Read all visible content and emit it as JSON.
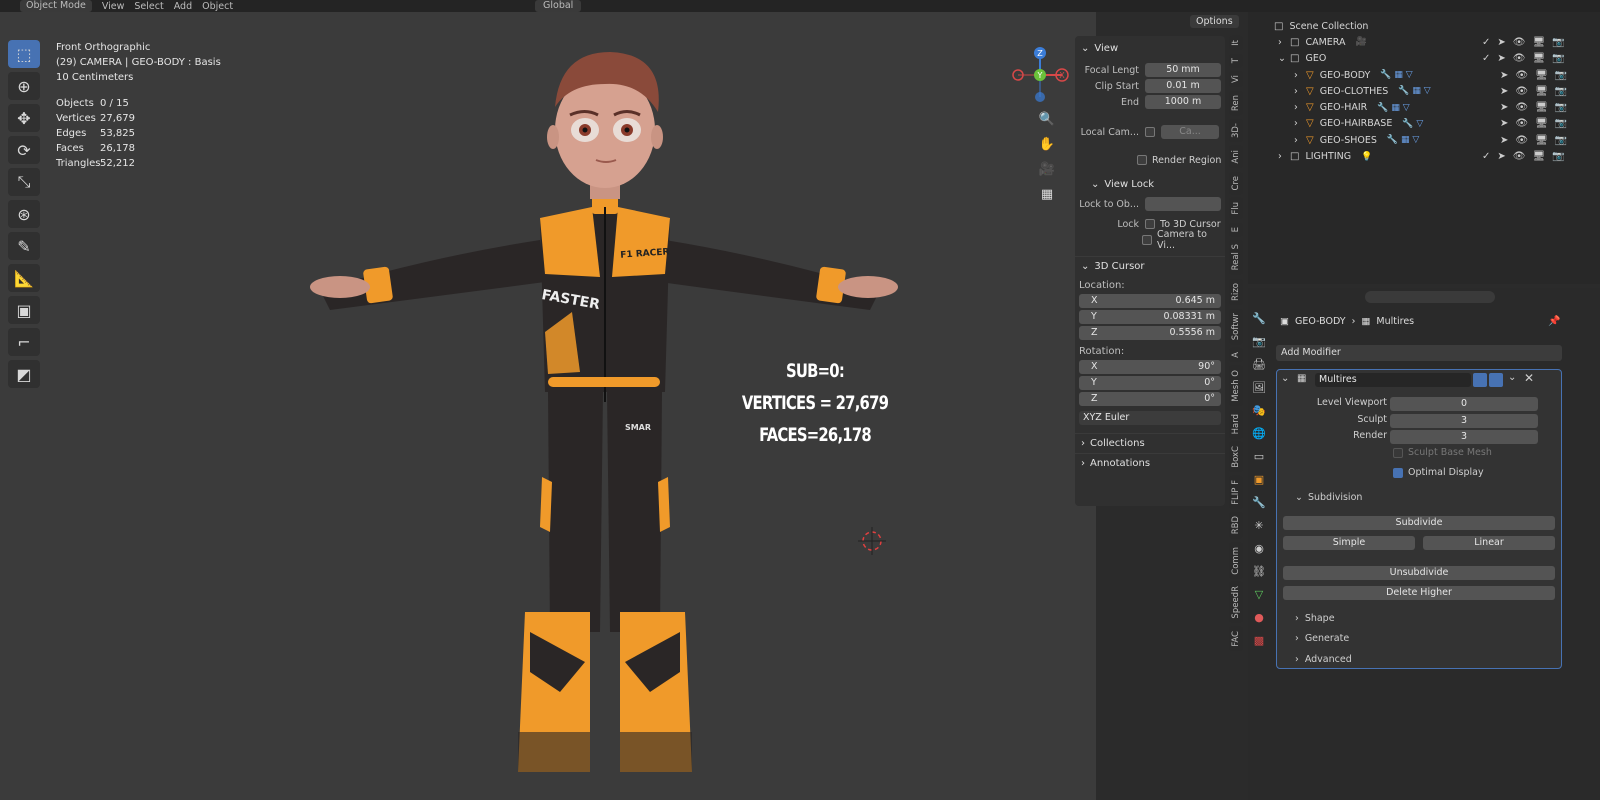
{
  "topbar": {
    "mode": "Object Mode",
    "menus": [
      "View",
      "Select",
      "Add",
      "Object"
    ],
    "orientation": "Global",
    "options": "Options"
  },
  "viewport": {
    "view_name": "Front Orthographic",
    "object_info": "(29) CAMERA | GEO-BODY : Basis",
    "scale": "10 Centimeters",
    "stats": [
      {
        "k": "Objects",
        "v": "0 / 15"
      },
      {
        "k": "Vertices",
        "v": "27,679"
      },
      {
        "k": "Edges",
        "v": "53,825"
      },
      {
        "k": "Faces",
        "v": "26,178"
      },
      {
        "k": "Triangles",
        "v": "52,212"
      }
    ],
    "annotation": [
      "SUB=0:",
      "VERTICES = 27,679",
      "FACES=26,178"
    ],
    "suit_texts": [
      "F1 RACER",
      "FASTER",
      "SMAR"
    ]
  },
  "npanel": {
    "view_header": "View",
    "focal_label": "Focal Lengt",
    "focal_value": "50 mm",
    "clip_start_label": "Clip Start",
    "clip_start_value": "0.01 m",
    "end_label": "End",
    "end_value": "1000 m",
    "local_cam_label": "Local Cam...",
    "local_cam_value": "Ca...",
    "render_region": "Render Region",
    "view_lock_header": "View Lock",
    "lock_to_obj_label": "Lock to Ob...",
    "lock_label": "Lock",
    "to_3d_cursor": "To 3D Cursor",
    "camera_to_view": "Camera to Vi...",
    "cursor_header": "3D Cursor",
    "location_label": "Location:",
    "loc": [
      {
        "axis": "X",
        "value": "0.645 m"
      },
      {
        "axis": "Y",
        "value": "0.08331 m"
      },
      {
        "axis": "Z",
        "value": "0.5556 m"
      }
    ],
    "rotation_label": "Rotation:",
    "rot": [
      {
        "axis": "X",
        "value": "90°"
      },
      {
        "axis": "Y",
        "value": "0°"
      },
      {
        "axis": "Z",
        "value": "0°"
      }
    ],
    "rot_mode": "XYZ Euler",
    "collections": "Collections",
    "annotations": "Annotations"
  },
  "sidetabs": [
    "It",
    "T",
    "Vi",
    "Ren",
    "3D-",
    "Ani",
    "Cre",
    "Flu",
    "E",
    "Real S",
    "Rizo",
    "Softwr",
    "A",
    "Mesh O",
    "Hard",
    "BoxC",
    "FLIP F",
    "RBD",
    "Comm",
    "SpeedR",
    "FAC"
  ],
  "outliner": {
    "rows": [
      {
        "indent": 0,
        "arrow": "",
        "icon": "□",
        "label": "Scene Collection",
        "extra": ""
      },
      {
        "indent": 1,
        "arrow": "›",
        "icon": "□",
        "label": "CAMERA",
        "extra": "🎥"
      },
      {
        "indent": 1,
        "arrow": "⌄",
        "icon": "□",
        "label": "GEO",
        "extra": ""
      },
      {
        "indent": 2,
        "arrow": "›",
        "icon": "▽",
        "label": "GEO-BODY",
        "extra": "🔧 ▦ ▽"
      },
      {
        "indent": 2,
        "arrow": "›",
        "icon": "▽",
        "label": "GEO-CLOTHES",
        "extra": "🔧 ▦ ▽"
      },
      {
        "indent": 2,
        "arrow": "›",
        "icon": "▽",
        "label": "GEO-HAIR",
        "extra": "🔧 ▦ ▽"
      },
      {
        "indent": 2,
        "arrow": "›",
        "icon": "▽",
        "label": "GEO-HAIRBASE",
        "extra": "🔧 ▽"
      },
      {
        "indent": 2,
        "arrow": "›",
        "icon": "▽",
        "label": "GEO-SHOES",
        "extra": "🔧 ▦ ▽"
      },
      {
        "indent": 1,
        "arrow": "›",
        "icon": "□",
        "label": "LIGHTING",
        "extra": "💡"
      }
    ]
  },
  "properties": {
    "breadcrumb_obj": "GEO-BODY",
    "breadcrumb_mod": "Multires",
    "add_modifier": "Add Modifier",
    "modifier_name": "Multires",
    "level_viewport_label": "Level Viewport",
    "level_viewport_value": "0",
    "sculpt_label": "Sculpt",
    "sculpt_value": "3",
    "render_label": "Render",
    "render_value": "3",
    "sculpt_base_mesh": "Sculpt Base Mesh",
    "optimal_display": "Optimal Display",
    "subdivision": "Subdivision",
    "subdivide": "Subdivide",
    "simple": "Simple",
    "linear": "Linear",
    "unsubdivide": "Unsubdivide",
    "delete_higher": "Delete Higher",
    "shape": "Shape",
    "generate": "Generate",
    "advanced": "Advanced"
  },
  "colors": {
    "accent": "#4772b3",
    "suit_orange": "#f09a2a",
    "suit_black": "#2a2626"
  }
}
